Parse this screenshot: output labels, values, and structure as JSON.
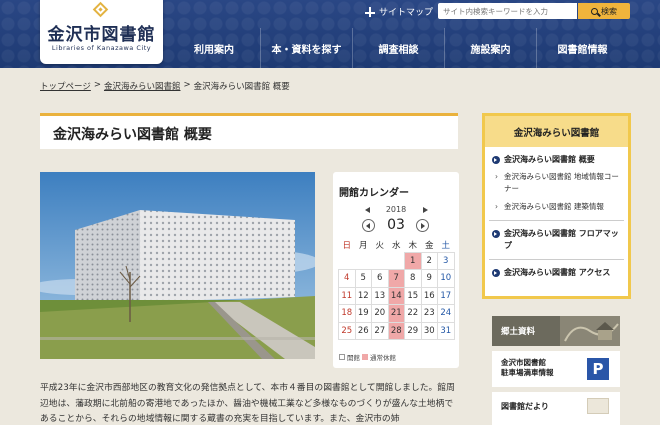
{
  "header": {
    "logo_title": "金沢市図書館",
    "logo_sub": "Libraries of Kanazawa City",
    "sitemap_label": "サイトマップ",
    "search_placeholder": "サイト内検索キーワードを入力",
    "search_button": "検索",
    "nav": [
      "利用案内",
      "本・資料を探す",
      "調査相談",
      "施設案内",
      "図書館情報"
    ]
  },
  "breadcrumb": {
    "items": [
      "トップページ",
      "金沢海みらい図書館"
    ],
    "separator": ">",
    "current": "金沢海みらい図書館 概要"
  },
  "page_title": "金沢海みらい図書館 概要",
  "calendar": {
    "title": "開館カレンダー",
    "year": "2018",
    "month": "03",
    "weekdays": [
      "日",
      "月",
      "火",
      "水",
      "木",
      "金",
      "土"
    ],
    "weeks": [
      [
        "",
        "",
        "",
        "",
        "1",
        "2",
        "3"
      ],
      [
        "4",
        "5",
        "6",
        "7",
        "8",
        "9",
        "10"
      ],
      [
        "11",
        "12",
        "13",
        "14",
        "15",
        "16",
        "17"
      ],
      [
        "18",
        "19",
        "20",
        "21",
        "22",
        "23",
        "24"
      ],
      [
        "25",
        "26",
        "27",
        "28",
        "29",
        "30",
        "31"
      ]
    ],
    "closed_days": [
      "1",
      "7",
      "14",
      "21",
      "28"
    ],
    "legend_open": "開館",
    "legend_closed": "通常休館",
    "closed_color": "#f0a8a8"
  },
  "paragraph": "平成23年に金沢市西部地区の教育文化の発信拠点として、本市４番目の図書館として開館しました。館周辺地は、藩政期に北前船の寄港地であったほか、醤油や機械工業など多様なものづくりが盛んな土地柄であることから、それらの地域情報に関する蔵書の充実を目指しています。また、金沢市の姉",
  "sidebar": {
    "heading": "金沢海みらい図書館",
    "items": [
      {
        "label": "金沢海みらい図書館 概要",
        "subs": [
          "金沢海みらい図書館 地域情報コーナー",
          "金沢海みらい図書館 建築情報"
        ]
      },
      {
        "label": "金沢海みらい図書館 フロアマップ",
        "subs": []
      },
      {
        "label": "金沢海みらい図書館 アクセス",
        "subs": []
      }
    ]
  },
  "banners": {
    "kyodo": "郷土資料",
    "parking_line1": "金沢市図書館",
    "parking_line2": "駐車場満車情報",
    "parking_icon": "P",
    "news": "図書館だより"
  },
  "colors": {
    "header_blue": "#1e3a73",
    "accent_yellow": "#eab23d",
    "search_button": "#f0b43c",
    "background": "#ece8de"
  }
}
